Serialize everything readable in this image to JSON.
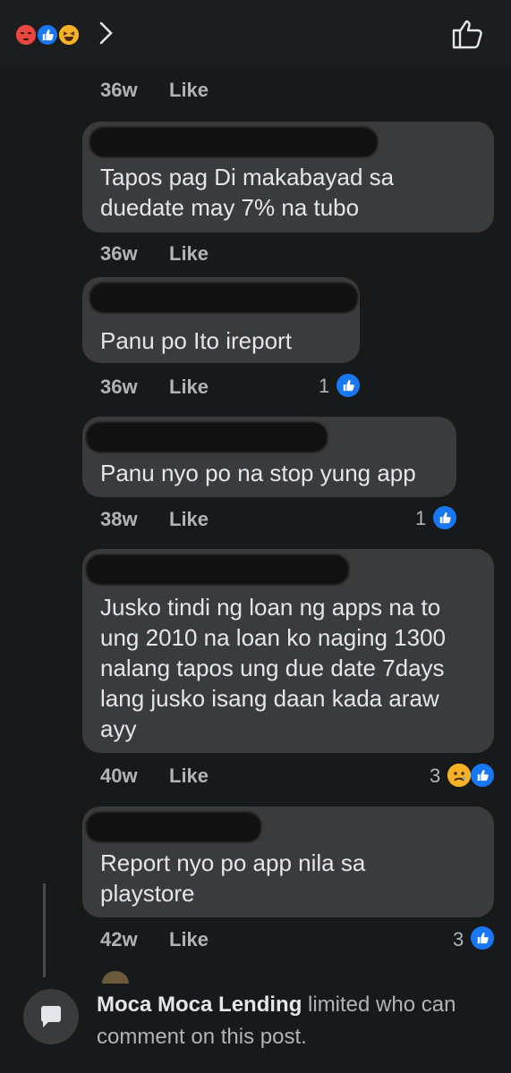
{
  "header": {
    "reactions": [
      "angry-icon",
      "like-icon",
      "haha-icon"
    ],
    "colors": {
      "angry": "#f25268",
      "like": "#1877f2",
      "haha": "#f7b125"
    }
  },
  "comments": [
    {
      "time": "36w",
      "like_label": "Like"
    },
    {
      "text": "Tapos pag Di makabayad sa\nduedate may 7% na tubo",
      "time": "36w",
      "like_label": "Like"
    },
    {
      "text": "Panu po Ito ireport",
      "time": "36w",
      "like_label": "Like",
      "reaction_count": "1"
    },
    {
      "text": "Panu nyo po na stop yung app",
      "time": "38w",
      "like_label": "Like",
      "reaction_count": "1"
    },
    {
      "text": "Jusko tindi ng loan ng apps na to\nung 2010 na loan ko naging 1300\nnalang tapos ung due date 7days\nlang jusko isang daan kada araw\nayy",
      "time": "40w",
      "like_label": "Like",
      "reaction_count": "3"
    },
    {
      "text": "Report nyo po app nila sa\nplaystore",
      "time": "42w",
      "like_label": "Like",
      "reaction_count": "3"
    }
  ],
  "notice": {
    "page_name": "Moca Moca Lending",
    "message": " limited who can comment on this post."
  }
}
